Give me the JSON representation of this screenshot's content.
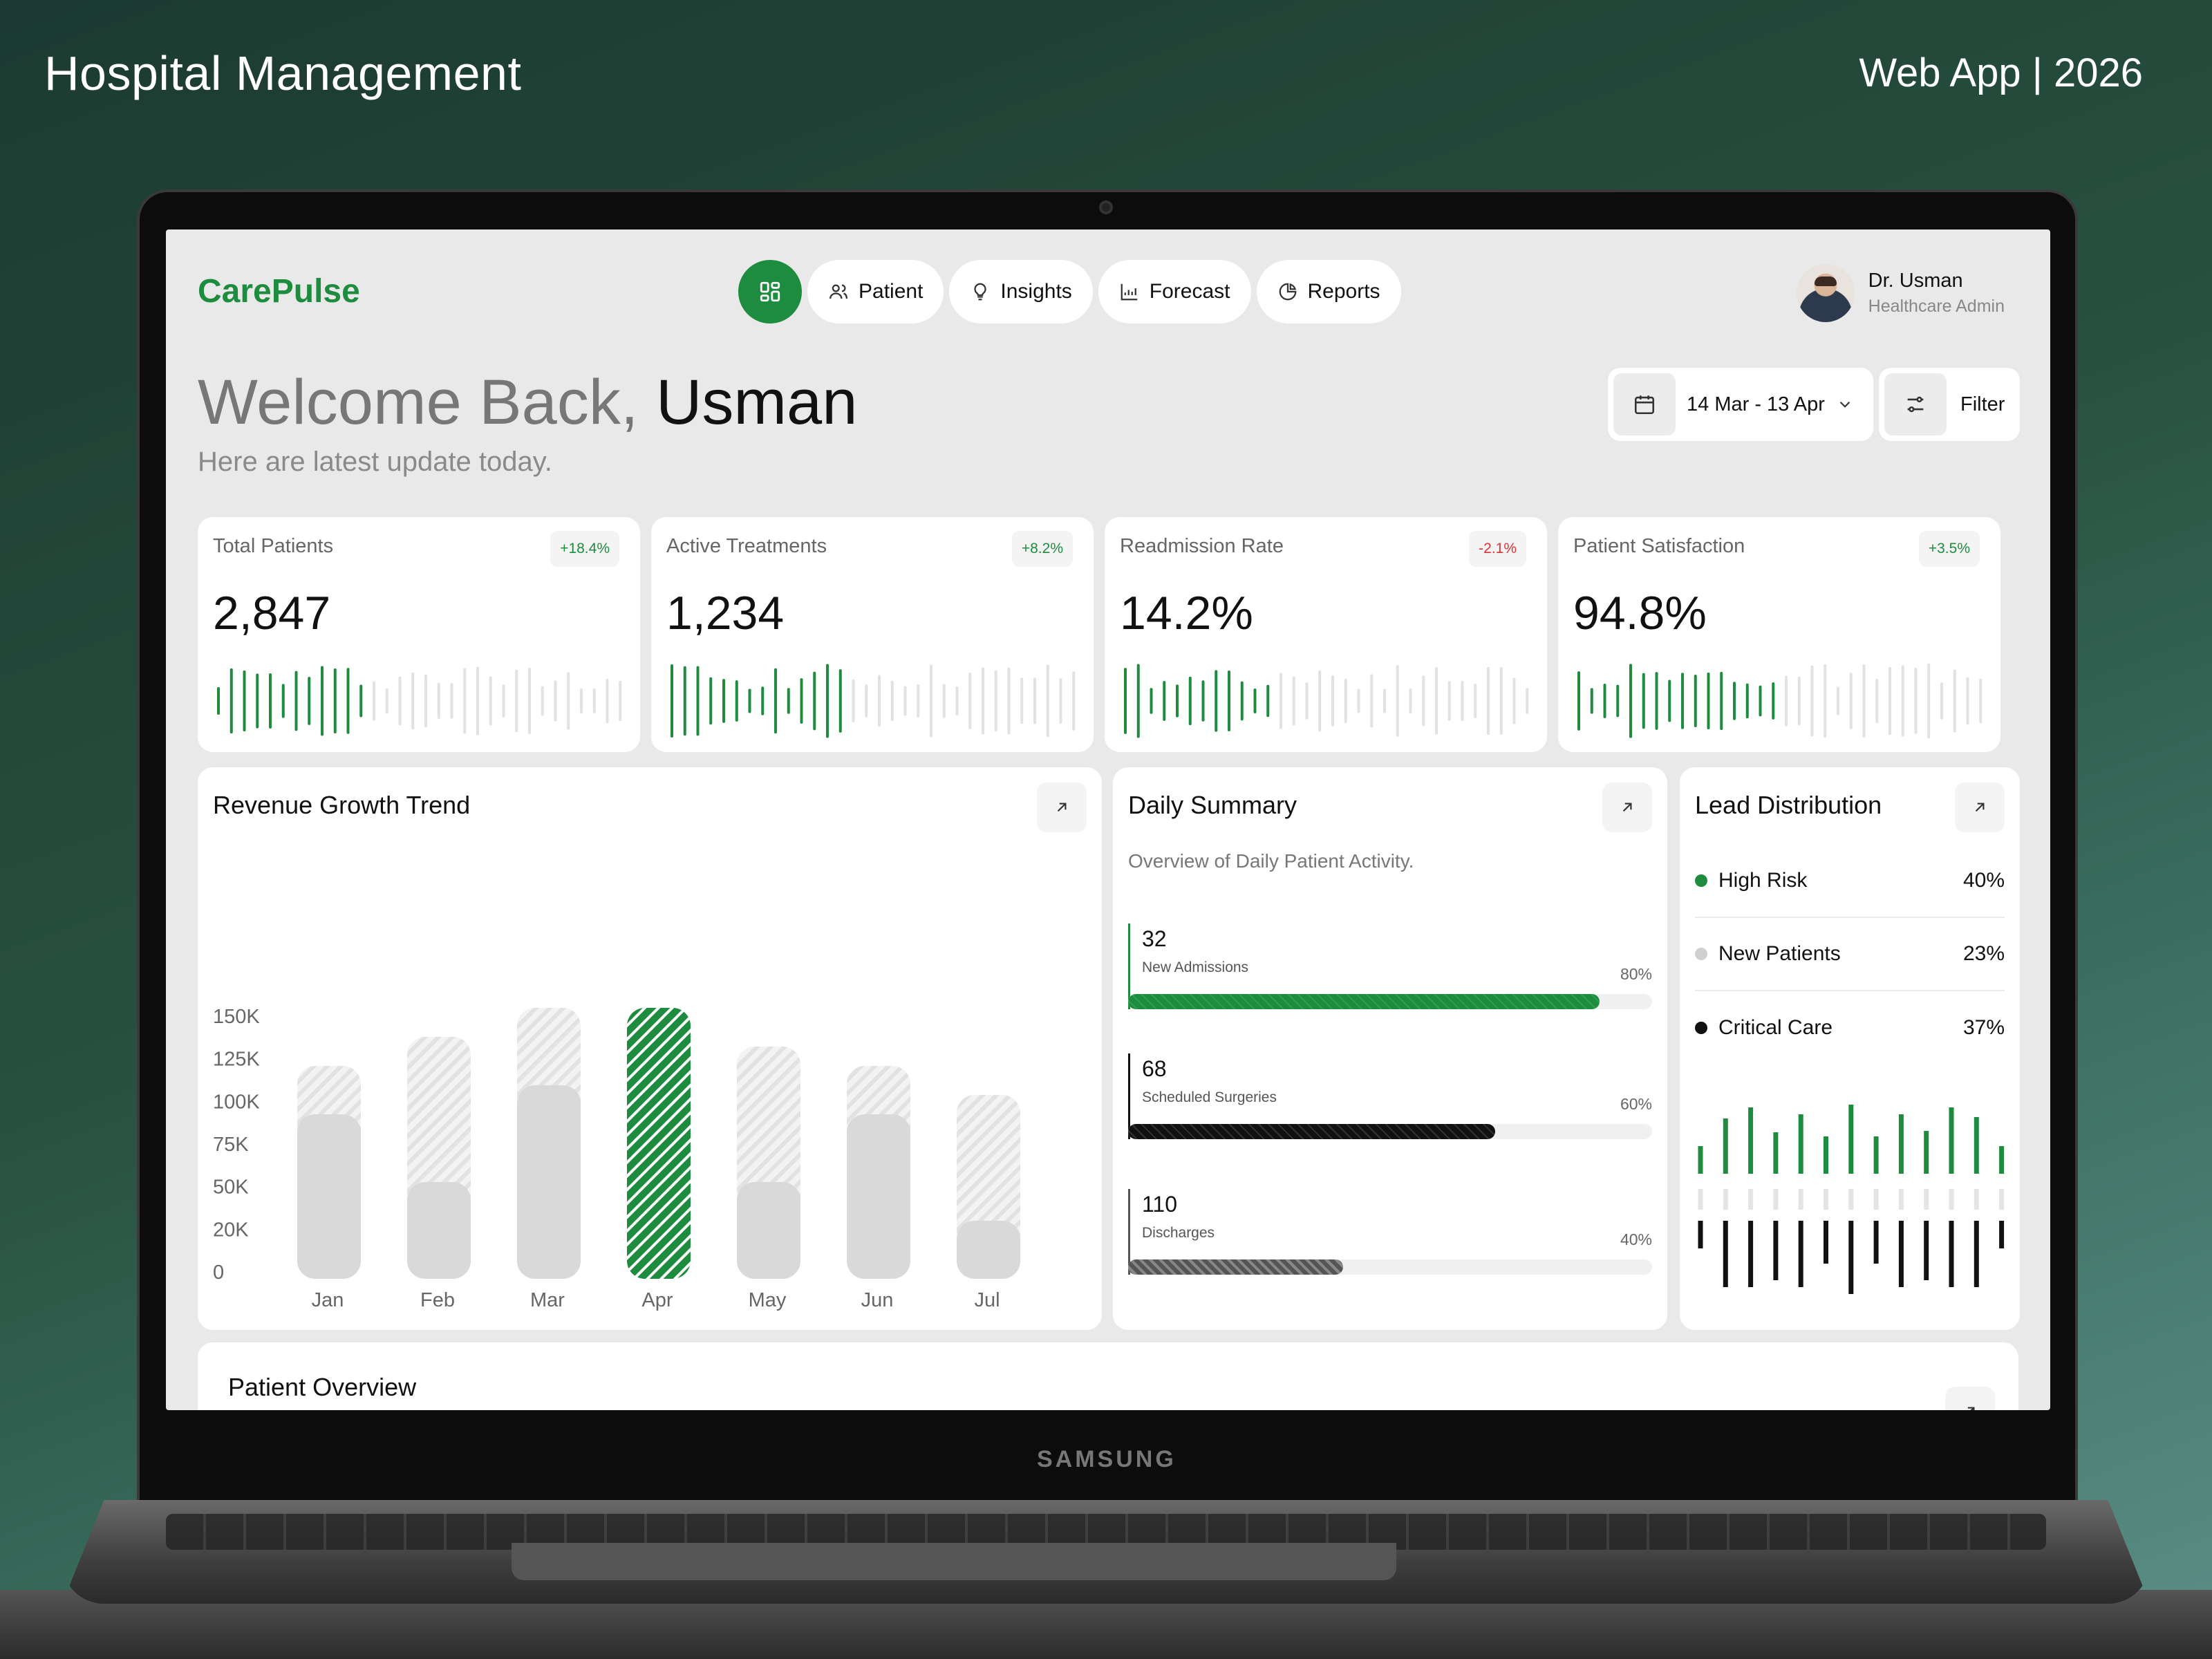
{
  "page": {
    "title": "Hospital Management",
    "tag": "Web App | 2026"
  },
  "device": {
    "brand": "SAMSUNG"
  },
  "app": {
    "logo": "CarePulse",
    "nav": [
      {
        "label": "Patient",
        "icon": "users-icon"
      },
      {
        "label": "Insights",
        "icon": "lightbulb-icon"
      },
      {
        "label": "Forecast",
        "icon": "chart-icon"
      },
      {
        "label": "Reports",
        "icon": "pie-icon"
      }
    ],
    "user": {
      "name": "Dr. Usman",
      "role": "Healthcare Admin"
    },
    "welcome": {
      "prefix": "Welcome Back,",
      "name": "Usman",
      "subtitle": "Here are latest update today."
    },
    "date_range": "14 Mar - 13 Apr",
    "filter_label": "Filter",
    "colors": {
      "accent": "#1e8c3e",
      "negative": "#e03131",
      "muted": "#d9d9d9"
    }
  },
  "kpis": [
    {
      "label": "Total Patients",
      "value": "2,847",
      "badge": "+18.4%",
      "trend": "up"
    },
    {
      "label": "Active Treatments",
      "value": "1,234",
      "badge": "+8.2%",
      "trend": "up"
    },
    {
      "label": "Readmission Rate",
      "value": "14.2%",
      "badge": "-2.1%",
      "trend": "down"
    },
    {
      "label": "Patient Satisfaction",
      "value": "94.8%",
      "badge": "+3.5%",
      "trend": "up"
    }
  ],
  "revenue": {
    "title": "Revenue Growth Trend"
  },
  "chart_data": {
    "type": "bar",
    "title": "Revenue Growth Trend",
    "categories": [
      "Jan",
      "Feb",
      "Mar",
      "Apr",
      "May",
      "Jun",
      "Jul"
    ],
    "y_ticks": [
      "150K",
      "125K",
      "100K",
      "75K",
      "50K",
      "20K",
      "0"
    ],
    "series": [
      {
        "values": [
          85,
          50,
          100,
          140,
          50,
          85,
          30
        ]
      },
      {
        "values": [
          110,
          125,
          140,
          140,
          120,
          110,
          95
        ]
      }
    ],
    "highlight": "Apr"
  },
  "daily": {
    "title": "Daily Summary",
    "subtitle": "Overview of Daily Patient Activity.",
    "items": [
      {
        "value": "32",
        "label": "New Admissions",
        "percent": "80%",
        "fill": 0.9,
        "color": "#1e8c3e"
      },
      {
        "value": "68",
        "label": "Scheduled Surgeries",
        "percent": "60%",
        "fill": 0.7,
        "color": "#111111"
      },
      {
        "value": "110",
        "label": "Discharges",
        "percent": "40%",
        "fill": 0.41,
        "color": "#555555"
      }
    ]
  },
  "lead": {
    "title": "Lead Distribution",
    "items": [
      {
        "label": "High Risk",
        "value": "40%",
        "color": "#1e8c3e"
      },
      {
        "label": "New Patients",
        "value": "23%",
        "color": "#cfcfcf"
      },
      {
        "label": "Critical Care",
        "value": "37%",
        "color": "#111111"
      }
    ]
  },
  "overview": {
    "title": "Patient Overview"
  }
}
